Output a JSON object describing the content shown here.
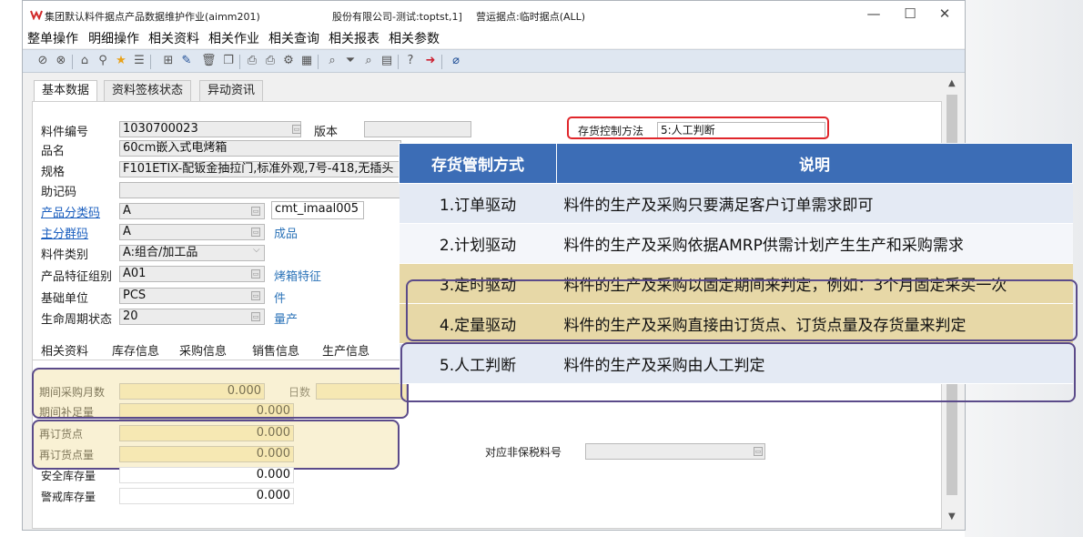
{
  "window": {
    "title": "集团默认料件据点产品数据维护作业(aimm201)",
    "company": "股份有限公司-测试:toptst,1]",
    "site": "营运据点:临时据点(ALL)",
    "controls": {
      "minimize": "—",
      "maximize": "☐",
      "close": "✕"
    }
  },
  "menu": [
    "整单操作",
    "明细操作",
    "相关资料",
    "相关作业",
    "相关查询",
    "相关报表",
    "相关参数"
  ],
  "toolbar_icons": [
    "confirm-icon",
    "cancel-icon",
    "home-icon",
    "location-icon",
    "star-icon",
    "list-icon",
    "add-icon",
    "edit-icon",
    "delete-icon",
    "copy-icon",
    "print-icon",
    "print-preview-icon",
    "print-setup-icon",
    "export-icon",
    "search-icon",
    "filter-icon",
    "advanced-query-icon",
    "report-icon",
    "help-icon",
    "exit-icon",
    "attach-icon"
  ],
  "tabs": [
    "基本数据",
    "资料签核状态",
    "异动资讯"
  ],
  "form": {
    "item_no_label": "料件编号",
    "item_no": "1030700023",
    "version_label": "版本",
    "version": "",
    "name_label": "品名",
    "name": "60cm嵌入式电烤箱",
    "spec_label": "规格",
    "spec": "F101ETIX-配钣金抽拉门,标准外观,7号-418,无插头",
    "mnemonic_label": "助记码",
    "mnemonic": "",
    "product_class_label": "产品分类码",
    "product_class": "A",
    "product_class_ref": "cmt_imaal005",
    "group_label": "主分群码",
    "group": "A",
    "group_desc": "成品",
    "category_label": "料件类别",
    "category": "A:组合/加工品",
    "feature_group_label": "产品特征组别",
    "feature_group": "A01",
    "feature_group_desc": "烤箱特征",
    "unit_label": "基础单位",
    "unit": "PCS",
    "unit_desc": "件",
    "lifecycle_label": "生命周期状态",
    "lifecycle": "20",
    "lifecycle_desc": "量产",
    "inv_control_label": "存货控制方法",
    "inv_control": "5:人工判断"
  },
  "subtabs": [
    "相关资料",
    "库存信息",
    "采购信息",
    "销售信息",
    "生产信息"
  ],
  "inventory": {
    "period_months_label": "期间采购月数",
    "period_months": "0.000",
    "days_label": "日数",
    "days": "",
    "period_replenish_label": "期间补足量",
    "period_replenish": "0.000",
    "reorder_point_label": "再订货点",
    "reorder_point": "0.000",
    "reorder_qty_label": "再订货点量",
    "reorder_qty": "0.000",
    "safety_stock_label": "安全库存量",
    "safety_stock": "0.000",
    "alert_stock_label": "警戒库存量",
    "alert_stock": "0.000",
    "bonded_label": "对应非保税料号",
    "bonded": ""
  },
  "overlay_table": {
    "headers": [
      "存货管制方式",
      "说明"
    ],
    "rows": [
      {
        "method": "1.订单驱动",
        "desc": "料件的生产及采购只要满足客户订单需求即可"
      },
      {
        "method": "2.计划驱动",
        "desc": "料件的生产及采购依据AMRP供需计划产生生产和采购需求"
      },
      {
        "method": "3.定时驱动",
        "desc": "料件的生产及采购以固定期间来判定，例如：3个月固定采买一次"
      },
      {
        "method": "4.定量驱动",
        "desc": "料件的生产及采购直接由订货点、订货点量及存货量来判定"
      },
      {
        "method": "5.人工判断",
        "desc": "料件的生产及采购由人工判定"
      }
    ]
  },
  "colors": {
    "header_blue": "#3c6db6",
    "highlight_red": "#e0262b",
    "highlight_purple": "#5b4b8a",
    "highlight_gold": "#e7d8a7"
  }
}
